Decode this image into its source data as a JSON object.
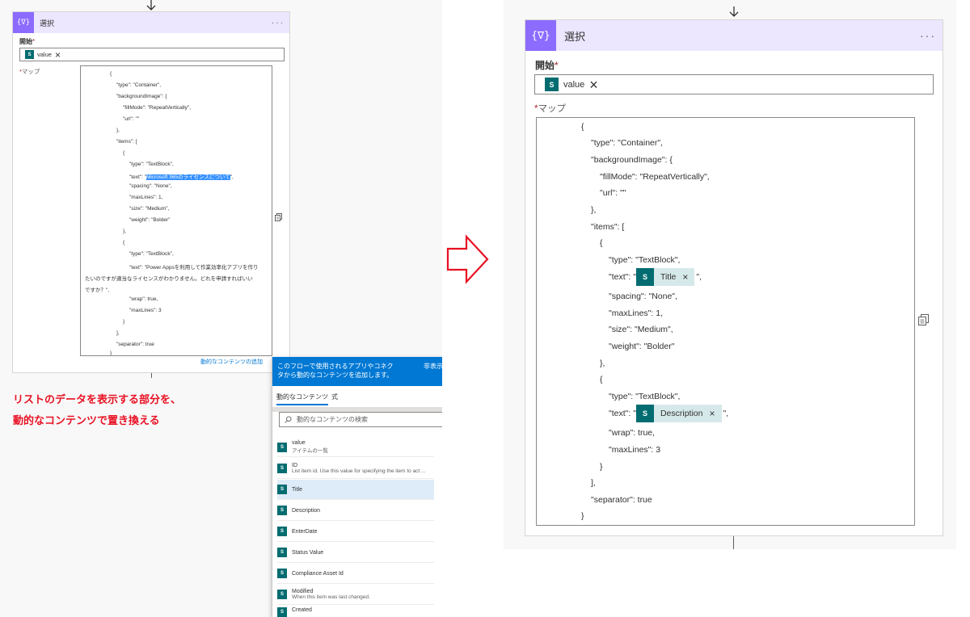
{
  "action": {
    "title": "選択",
    "icon": "{∇}",
    "more": "···",
    "from_label": "開始",
    "map_label": "マップ",
    "required_mark": "*",
    "from_token": {
      "icon": "S",
      "label": "value"
    }
  },
  "left_code": [
    "{",
    "\"type\": \"Container\",",
    "\"backgroundImage\": {",
    "\"fillMode\": \"RepeatVertically\",",
    "\"url\": \"\"",
    "},",
    "\"items\": [",
    "{",
    "\"type\": \"TextBlock\",",
    "\"text\": \"",
    "Microsoft 365のライセンスについて",
    "\",",
    "\"spacing\": \"None\",",
    "\"maxLines\": 1,",
    "\"size\": \"Medium\",",
    "\"weight\": \"Bolder\"",
    "},",
    "{",
    "\"type\": \"TextBlock\",",
    "\"text\": \"Power Appsを利用して作業効率化アプリを作り",
    "たいのですが適当なライセンスがわかりません。どれを申請すればいい",
    "ですか？\",",
    "\"wrap\": true,",
    "\"maxLines\": 3",
    "}",
    "],",
    "\"separator\": true",
    "}"
  ],
  "right_code": {
    "open": "{",
    "type_container": "\"type\": \"Container\",",
    "bg": "\"backgroundImage\": {",
    "fill": "\"fillMode\": \"RepeatVertically\",",
    "url": "\"url\": \"\"",
    "close_bg": "},",
    "items": "\"items\": [",
    "open1": "{",
    "type1": "\"type\": \"TextBlock\",",
    "text1_pre": "\"text\": \"",
    "text1_token": "Title",
    "text1_post": "\",",
    "spacing": "\"spacing\": \"None\",",
    "maxlines1": "\"maxLines\": 1,",
    "size": "\"size\": \"Medium\",",
    "weight": "\"weight\": \"Bolder\"",
    "close1": "},",
    "open2": "{",
    "type2": "\"type\": \"TextBlock\",",
    "text2_pre": "\"text\": \"",
    "text2_token": "Description",
    "text2_post": "\",",
    "wrap": "\"wrap\": true,",
    "maxlines2": "\"maxLines\": 3",
    "close2": "}",
    "close_items": "],",
    "separator": "\"separator\": true",
    "close": "}"
  },
  "token_close": "×",
  "dynamic": {
    "add_link": "動的なコンテンツの追加",
    "popup_text": "このフローで使用されるアプリやコネクタから動的なコンテンツを追加します。",
    "hide": "非表示",
    "tab_dynamic": "動的なコンテンツ",
    "tab_expression": "式",
    "search_placeholder": "動的なコンテンツの検索",
    "items": [
      {
        "name": "value",
        "desc": "アイテムの一覧"
      },
      {
        "name": "ID",
        "desc": "List item id. Use this value for specifying the item to act ..."
      },
      {
        "name": "Title",
        "desc": ""
      },
      {
        "name": "Description",
        "desc": ""
      },
      {
        "name": "EnterDate",
        "desc": ""
      },
      {
        "name": "Status Value",
        "desc": ""
      },
      {
        "name": "Compliance Asset Id",
        "desc": ""
      },
      {
        "name": "Modified",
        "desc": "When this item was last changed."
      },
      {
        "name": "Created",
        "desc": ""
      }
    ]
  },
  "annotation": {
    "line1": "リストのデータを表示する部分を、",
    "line2": "動的なコンテンツで置き換える"
  },
  "colors": {
    "header_bg": "#ece6ff",
    "op_icon": "#8c6cff",
    "sharepoint": "#036c70",
    "token_bg": "#d6e9ea",
    "accent": "#0078d4",
    "annotation": "#e81123"
  }
}
